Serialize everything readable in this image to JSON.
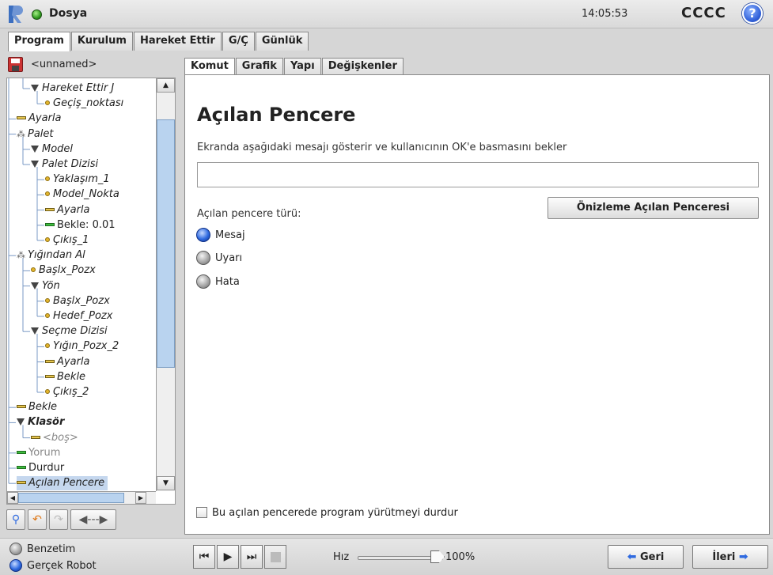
{
  "topbar": {
    "file_label": "Dosya",
    "clock": "14:05:53",
    "robot_name": "CCCC",
    "help_label": "?"
  },
  "main_tabs": [
    "Program",
    "Kurulum",
    "Hareket Ettir",
    "G/Ç",
    "Günlük"
  ],
  "program": {
    "name": "<unnamed>"
  },
  "tree": [
    {
      "label": "Hareket Ettir J",
      "icon": "triangle",
      "style": "it"
    },
    {
      "label": "Geçiş_noktası",
      "icon": "dot",
      "style": "it"
    },
    {
      "label": "Ayarla",
      "icon": "bar",
      "style": "it"
    },
    {
      "label": "Palet",
      "icon": "pallet",
      "style": "it"
    },
    {
      "label": "Model",
      "icon": "triangle",
      "style": "it"
    },
    {
      "label": "Palet Dizisi",
      "icon": "triangle",
      "style": "it"
    },
    {
      "label": "Yaklaşım_1",
      "icon": "dot",
      "style": "it"
    },
    {
      "label": "Model_Nokta",
      "icon": "dot",
      "style": "it"
    },
    {
      "label": "Ayarla",
      "icon": "bar",
      "style": "it"
    },
    {
      "label": "Bekle: 0.01",
      "icon": "bar-green",
      "style": ""
    },
    {
      "label": "Çıkış_1",
      "icon": "dot",
      "style": "it"
    },
    {
      "label": "Yığından Al",
      "icon": "pallet",
      "style": "it"
    },
    {
      "label": "Başlx_Pozx",
      "icon": "dot",
      "style": "it"
    },
    {
      "label": "Yön",
      "icon": "triangle",
      "style": "it"
    },
    {
      "label": "Başlx_Pozx",
      "icon": "dot",
      "style": "it"
    },
    {
      "label": "Hedef_Pozx",
      "icon": "dot",
      "style": "it"
    },
    {
      "label": "Seçme Dizisi",
      "icon": "triangle",
      "style": "it"
    },
    {
      "label": "Yığın_Pozx_2",
      "icon": "dot",
      "style": "it"
    },
    {
      "label": "Ayarla",
      "icon": "bar",
      "style": "it"
    },
    {
      "label": "Bekle",
      "icon": "bar",
      "style": "it"
    },
    {
      "label": "Çıkış_2",
      "icon": "dot",
      "style": "it"
    },
    {
      "label": "Bekle",
      "icon": "bar",
      "style": "it"
    },
    {
      "label": "Klasör",
      "icon": "triangle",
      "style": "bold"
    },
    {
      "label": "<boş>",
      "icon": "bar",
      "style": "it grey"
    },
    {
      "label": "Yorum",
      "icon": "bar-green",
      "style": "grey"
    },
    {
      "label": "Durdur",
      "icon": "bar-green",
      "style": ""
    },
    {
      "label": "Açılan Pencere",
      "icon": "bar",
      "style": "it sel"
    }
  ],
  "sub_tabs": [
    "Komut",
    "Grafik",
    "Yapı",
    "Değişkenler"
  ],
  "popup": {
    "title": "Açılan Pencere",
    "description": "Ekranda aşağıdaki mesajı gösterir ve kullanıcının OK'e basmasını bekler",
    "message_value": "",
    "preview_label": "Önizleme Açılan Penceresi",
    "type_label": "Açılan pencere türü:",
    "types": [
      {
        "label": "Mesaj",
        "selected": true
      },
      {
        "label": "Uyarı",
        "selected": false
      },
      {
        "label": "Hata",
        "selected": false
      }
    ],
    "stop_label": "Bu açılan pencerede program yürütmeyi durdur"
  },
  "bottombar": {
    "mode_sim": "Benzetim",
    "mode_real": "Gerçek Robot",
    "speed_label": "Hız",
    "speed_value": "100%",
    "speed_fraction": 1.0,
    "back_label": "Geri",
    "next_label": "İleri"
  }
}
